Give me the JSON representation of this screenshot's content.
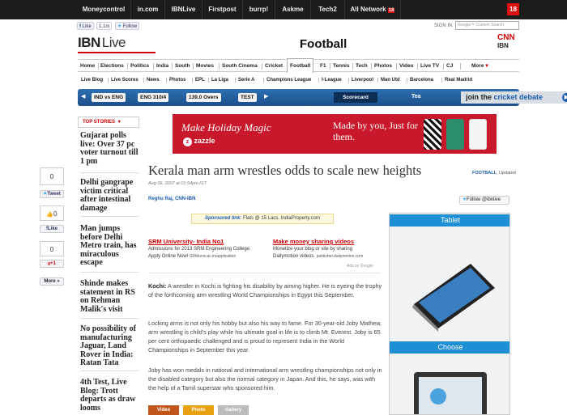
{
  "topbar": {
    "links": [
      "Moneycontrol",
      "in.com",
      "IBNLive",
      "Firstpost",
      "burrp!",
      "Askme",
      "Tech2",
      "All Network"
    ],
    "network_badge": "18",
    "logo18": "18"
  },
  "social": {
    "like": "Like",
    "like_count": "1.1m",
    "follow": "Follow"
  },
  "header": {
    "logo_ibn": "IBN",
    "logo_live": "Live",
    "section": "Football",
    "signin": "SIGN IN",
    "search_placeholder": "Google™ Custom Search",
    "cnn": "CNN",
    "ibn": "IBN"
  },
  "nav1": [
    "Home",
    "Elections",
    "Politics",
    "India",
    "South",
    "Movies",
    "South Cinema",
    "Cricket",
    "Football",
    "F1",
    "Tennis",
    "Tech",
    "Photos",
    "Video",
    "Live TV",
    "CJ",
    "More"
  ],
  "nav1_more_arrow": "▾",
  "nav2": [
    "Live Blog",
    "Live Scores",
    "News",
    "Photos",
    "EPL",
    "La Liga",
    "Serie A",
    "Champions League",
    "I-League",
    "Liverpool",
    "Man Utd",
    "Barcelona",
    "Real Madrid"
  ],
  "scorebar": {
    "prev": "◀",
    "next": "▶",
    "match": "IND vs ENG",
    "score": "ENG  310/4",
    "overs": "139.0 Overs",
    "format": "TEST",
    "scorecard": "Scorecard",
    "status": "Tea",
    "debate_prefix": "join the",
    "debate_highlight": "cricket debate",
    "debate_arrow": "▶"
  },
  "top_stories": {
    "label": "TOP STORIES",
    "arrow": "▾",
    "items": [
      "Gujarat polls live: Over 37 pc voter turnout till 1 pm",
      "Delhi gangrape victim critical after intestinal damage",
      "Man jumps before Delhi Metro train, has miraculous escape",
      "Shinde makes statement in RS on Rehman Malik's visit",
      "No possibility of manufacturing Jaguar, Land Rover in India: Ratan Tata",
      "4th Test, Live Blog: Trott departs as draw looms"
    ]
  },
  "share": {
    "tweet_count": "0",
    "tweet": "Tweet",
    "like_count": "0",
    "like": "Like",
    "plus_count": "0",
    "plus": "+1",
    "more": "More »"
  },
  "ad_banner": {
    "headline": "Make Holiday Magic",
    "brand": "zazzle",
    "tagline": "Made by you, Just for them."
  },
  "article": {
    "title": "Kerala man arm wrestles odds to scale new heights",
    "category": "FOOTBALL",
    "updated": "Updated",
    "date": "Aug 06, 2007 at 01:54pm IST",
    "author": "Reghu Raj, CNN-IBN",
    "follow": "Follow @ibnlive",
    "sponsored_label": "Sponsored link:",
    "sponsored_text": "Flats @ 15 Lacs. IndiaProperty.com",
    "lead_label": "Kochi:",
    "paragraphs": [
      "A wrestler in Kochi is fighting his disability by aiming higher. He is eyeing the trophy of the forthcoming arm wrestling World Championships in Egypt this September.",
      "Locking arms is not only his hobby but also his way to fame. For 30-year-old Joby Mathew, arm wrestling is child's play while his ultimate goal in life is to climb Mt. Everest. Joby is 65 per cent orthopaedic challenged and is proud to represent India in the World Championships in September this year.",
      "Joby has won medals in national and international arm wrestling championships not only in the disabled category but also the normal category in Japan. And this, he says, was with the help of a Tamil superstar who sponsored him."
    ],
    "media_tabs": [
      "Video",
      "Photo",
      "Gallery"
    ]
  },
  "text_ads": [
    {
      "title": "SRM University- India No1",
      "lines": [
        "Admissions for 2013 SRM Engineering College.",
        "Apply Online Now!"
      ],
      "url": "SRMuniv.ac.in/application"
    },
    {
      "title": "Make money sharing videos",
      "lines": [
        "Monetize your blog or site by sharing",
        "Dailymotion videos."
      ],
      "url": "publisher.dailymotion.com"
    }
  ],
  "ads_by": "Ads by Google",
  "side_ad": {
    "top_label": "Tablet",
    "bottom_label": "Choose"
  },
  "colors": {
    "brand_red": "#cc0000",
    "nav_blue": "#1b4f8a",
    "link_blue": "#1a5cb0",
    "tablet_blue": "#1c8fd5",
    "video_tab": "#c0561a",
    "photo_tab": "#e8a010",
    "gallery_tab": "#bbbbbb"
  }
}
